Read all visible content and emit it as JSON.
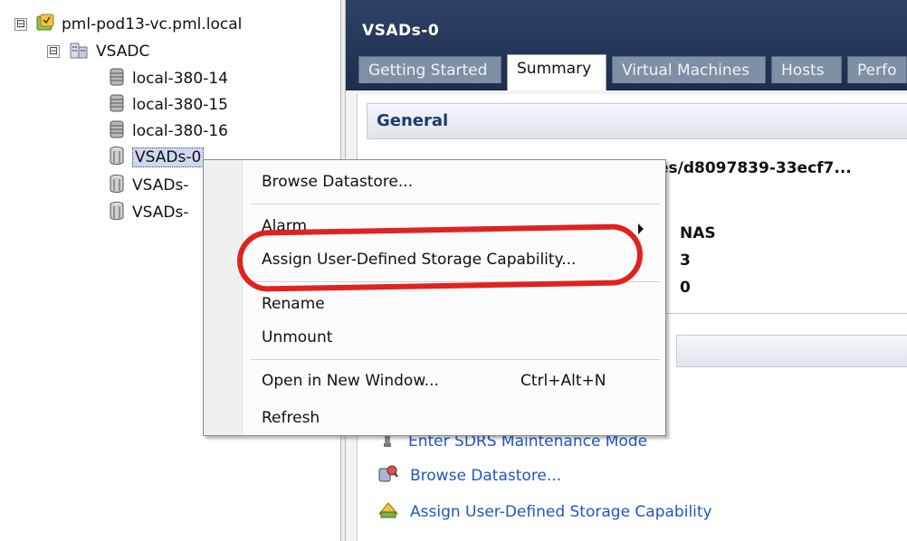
{
  "tree": {
    "vcenter": "pml-pod13-vc.pml.local",
    "datacenter": "VSADC",
    "items": [
      {
        "label": "local-380-14",
        "type": "datastore-local"
      },
      {
        "label": "local-380-15",
        "type": "datastore-local"
      },
      {
        "label": "local-380-16",
        "type": "datastore-local"
      },
      {
        "label": "VSADs-0",
        "type": "datastore-nfs",
        "selected": true
      },
      {
        "label": "VSADs-",
        "type": "datastore-nfs"
      },
      {
        "label": "VSADs-",
        "type": "datastore-nfs"
      }
    ],
    "expand_symbol": "⊟"
  },
  "panel": {
    "title": "VSADs-0",
    "tabs": [
      "Getting Started",
      "Summary",
      "Virtual Machines",
      "Hosts",
      "Perfo"
    ],
    "active_tab": "Summary",
    "general_title": "General",
    "partial_path": "es/d8097839-33ecf7...",
    "values": [
      "NAS",
      "3",
      "0"
    ],
    "commands": [
      {
        "label": "Enter SDRS Maintenance Mode",
        "icon": "maintenance-mode-icon"
      },
      {
        "label": "Browse Datastore...",
        "icon": "browse-datastore-icon"
      },
      {
        "label": "Assign User-Defined Storage Capability",
        "icon": "storage-capability-icon"
      }
    ]
  },
  "context_menu": {
    "items": {
      "browse": "Browse Datastore...",
      "alarm": "Alarm",
      "assign": "Assign User-Defined Storage Capability...",
      "rename": "Rename",
      "unmount": "Unmount",
      "open_new": "Open in New Window...",
      "open_new_shortcut": "Ctrl+Alt+N",
      "refresh": "Refresh"
    }
  },
  "colors": {
    "header_bg": "#2d4266",
    "link": "#1f56c8",
    "highlight": "#e0231e"
  }
}
